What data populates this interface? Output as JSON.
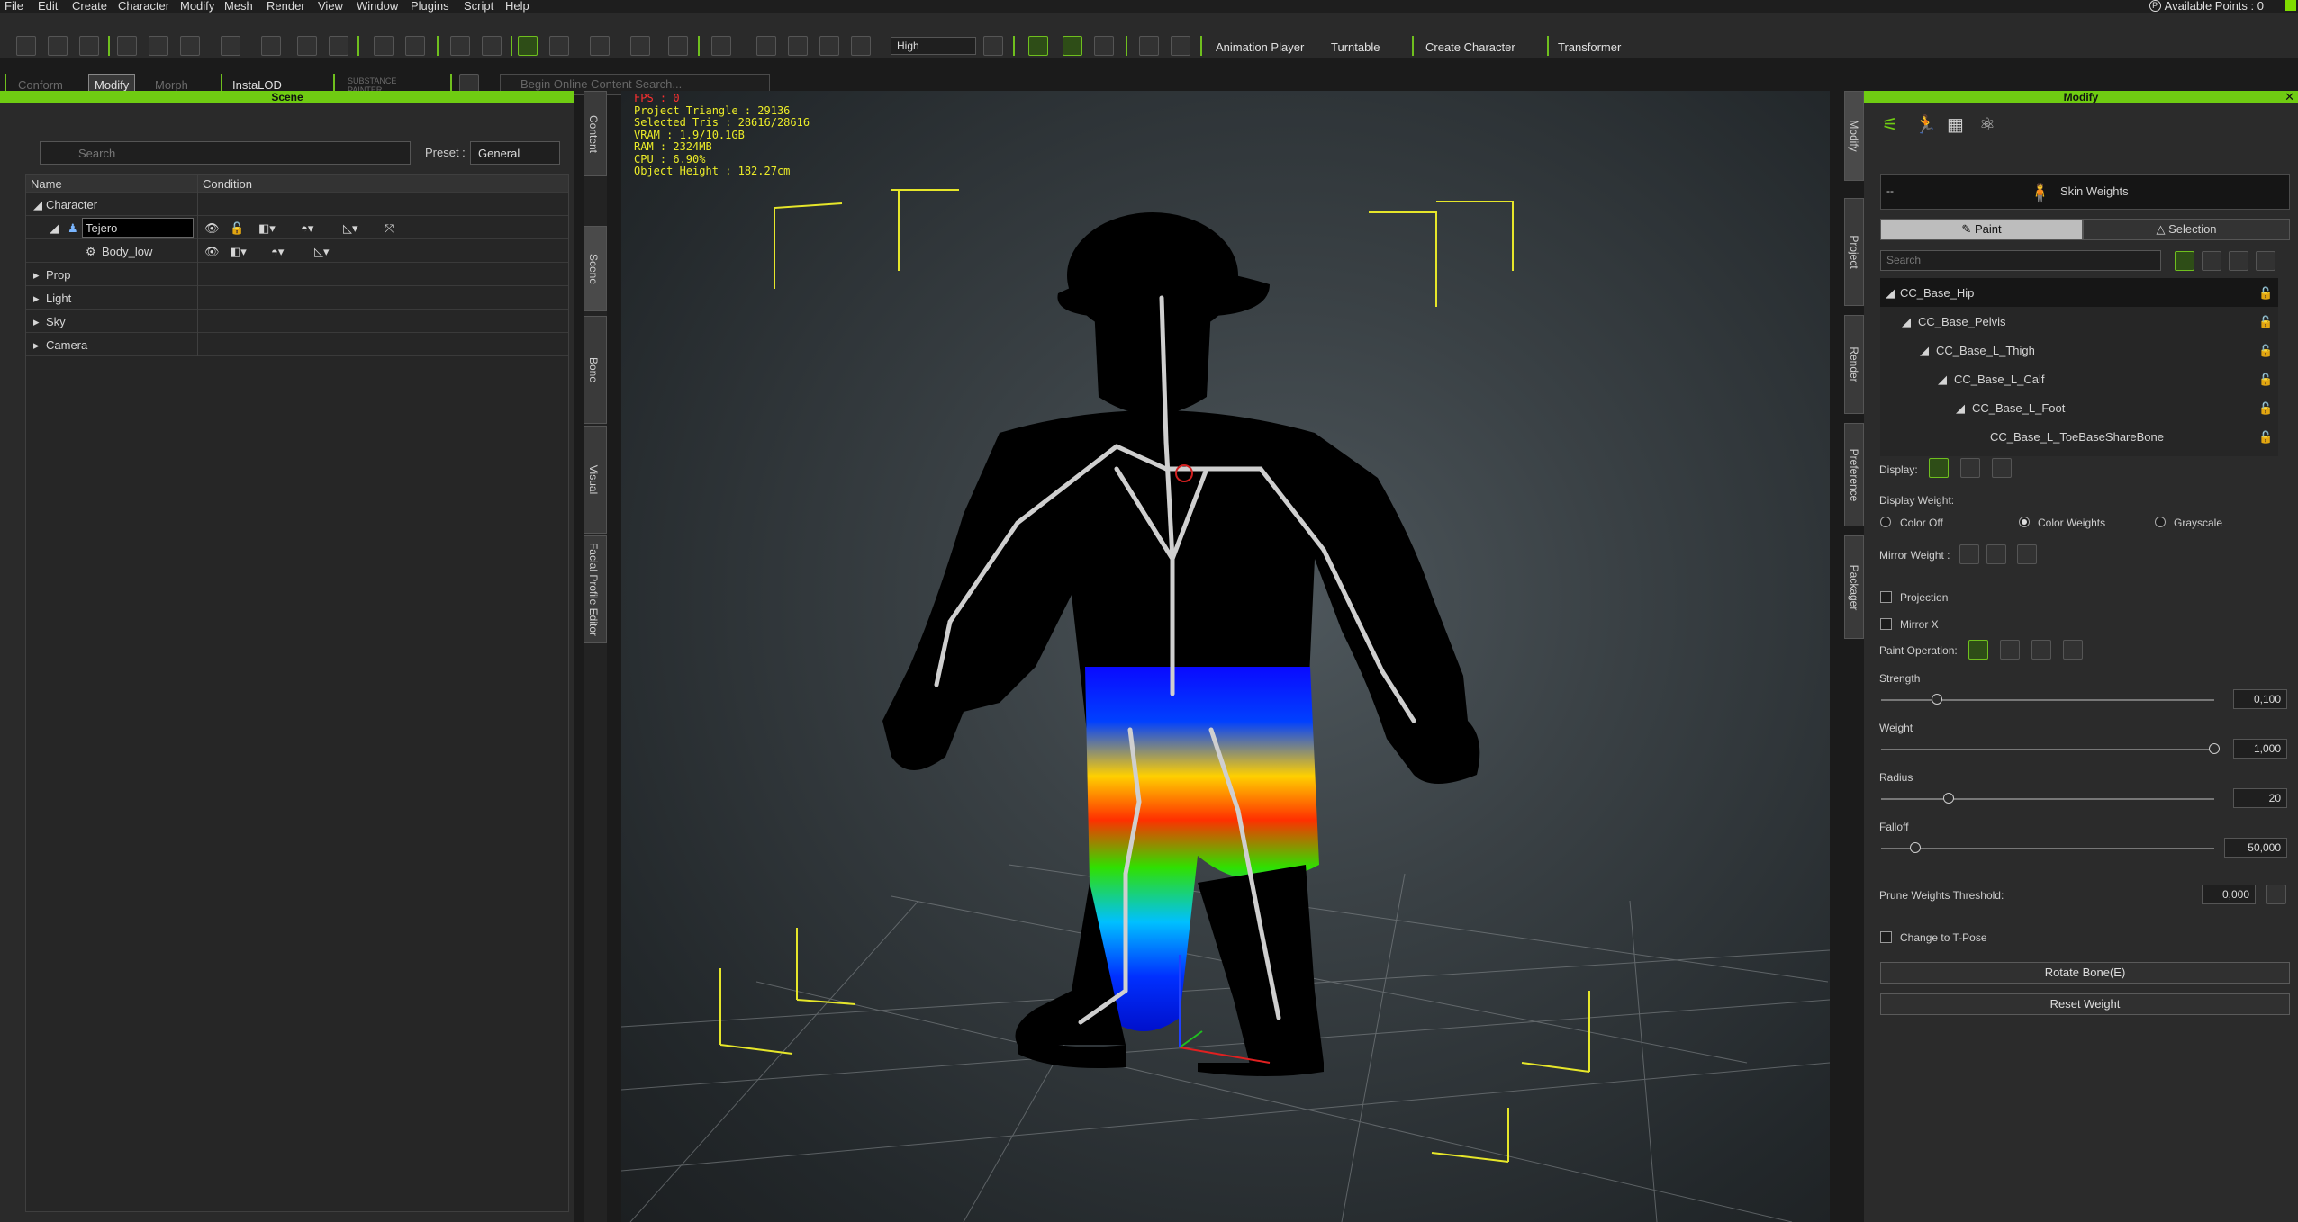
{
  "menu": [
    "File",
    "Edit",
    "Create",
    "Character",
    "Modify",
    "Mesh",
    "Render",
    "View",
    "Window",
    "Plugins",
    "Script",
    "Help"
  ],
  "available_points": "Available Points : 0",
  "toolbar": {
    "quality": "High",
    "animation_player": "Animation Player",
    "turntable": "Turntable",
    "create_character": "Create Character",
    "transformer": "Transformer",
    "conform": "Conform",
    "modify": "Modify",
    "morph": "Morph",
    "instalod": "InstaLOD",
    "substance": "SUBSTANCE PAINTER",
    "content_search_placeholder": "Begin Online Content Search..."
  },
  "scene": {
    "title": "Scene",
    "search_placeholder": "Search",
    "preset_label": "Preset :",
    "preset_value": "General",
    "col_name": "Name",
    "col_condition": "Condition",
    "rows": [
      "Character",
      "Tejero",
      "Body_low",
      "Prop",
      "Light",
      "Sky",
      "Camera"
    ]
  },
  "left_tabs": [
    "Content",
    "Scene",
    "Bone",
    "Visual",
    "Facial Profile Editor"
  ],
  "viewport": {
    "fps": "FPS : 0",
    "project_triangle": "Project Triangle : 29136",
    "selected_tris": "Selected Tris : 28616/28616",
    "vram": "VRAM : 1.9/10.1GB",
    "ram": "RAM : 2324MB",
    "cpu": "CPU : 6.90%",
    "object_height": "Object Height : 182.27cm"
  },
  "right_tabs": [
    "Modify",
    "Project",
    "Render",
    "Preference",
    "Packager"
  ],
  "modify": {
    "title": "Modify",
    "header_dash": "--",
    "skin_weights": "Skin Weights",
    "paint": "Paint",
    "selection": "Selection",
    "search_placeholder": "Search",
    "bones": [
      "CC_Base_Hip",
      "CC_Base_Pelvis",
      "CC_Base_L_Thigh",
      "CC_Base_L_Calf",
      "CC_Base_L_Foot",
      "CC_Base_L_ToeBaseShareBone"
    ],
    "display_label": "Display:",
    "display_weight_label": "Display Weight:",
    "color_off": "Color Off",
    "color_weights": "Color Weights",
    "grayscale": "Grayscale",
    "mirror_weight_label": "Mirror Weight :",
    "projection": "Projection",
    "mirror_x": "Mirror X",
    "paint_operation_label": "Paint Operation:",
    "strength_label": "Strength",
    "strength_value": "0,100",
    "strength_fraction": 0.1,
    "weight_label": "Weight",
    "weight_value": "1,000",
    "weight_fraction": 1.0,
    "radius_label": "Radius",
    "radius_value": "20",
    "falloff_label": "Falloff",
    "falloff_value": "50,000",
    "prune_label": "Prune Weights Threshold:",
    "prune_value": "0,000",
    "change_tpose": "Change to T-Pose",
    "rotate_bone": "Rotate Bone(E)",
    "reset_weight": "Reset Weight"
  },
  "colors": {
    "accent": "#6fcc12",
    "stats": "#ecec28",
    "fps": "#ff3030"
  }
}
